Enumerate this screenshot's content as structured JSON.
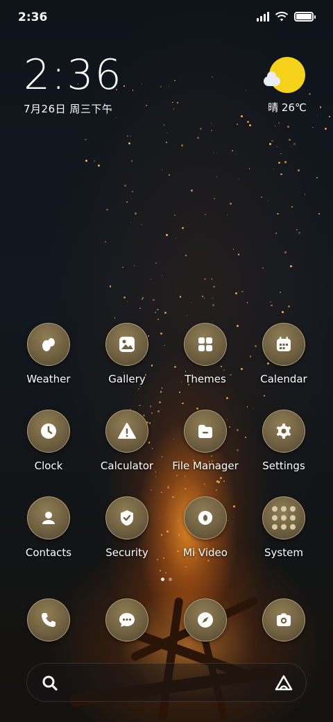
{
  "status_bar": {
    "time": "2:36"
  },
  "clock_widget": {
    "time": "2:36",
    "date": "7月26日 周三下午"
  },
  "weather_widget": {
    "text": "晴 26℃"
  },
  "apps": [
    {
      "label": "Weather",
      "icon": "weather-icon"
    },
    {
      "label": "Gallery",
      "icon": "gallery-icon"
    },
    {
      "label": "Themes",
      "icon": "themes-icon"
    },
    {
      "label": "Calendar",
      "icon": "calendar-icon"
    },
    {
      "label": "Clock",
      "icon": "clock-icon"
    },
    {
      "label": "Calculator",
      "icon": "calculator-icon"
    },
    {
      "label": "File Manager",
      "icon": "file-manager-icon"
    },
    {
      "label": "Settings",
      "icon": "settings-icon"
    },
    {
      "label": "Contacts",
      "icon": "contacts-icon"
    },
    {
      "label": "Security",
      "icon": "security-icon"
    },
    {
      "label": "Mi Video",
      "icon": "mi-video-icon"
    },
    {
      "label": "System",
      "icon": "system-folder-icon"
    }
  ],
  "dock": [
    {
      "icon": "phone-icon"
    },
    {
      "icon": "messages-icon"
    },
    {
      "icon": "browser-icon"
    },
    {
      "icon": "camera-icon"
    }
  ],
  "search_bar": {
    "search_icon": "search-icon",
    "assistant_icon": "app-vault-icon"
  },
  "colors": {
    "icon_bg": "#7a6a48",
    "sun": "#f7d21a",
    "fire": "#ff9a2e"
  }
}
